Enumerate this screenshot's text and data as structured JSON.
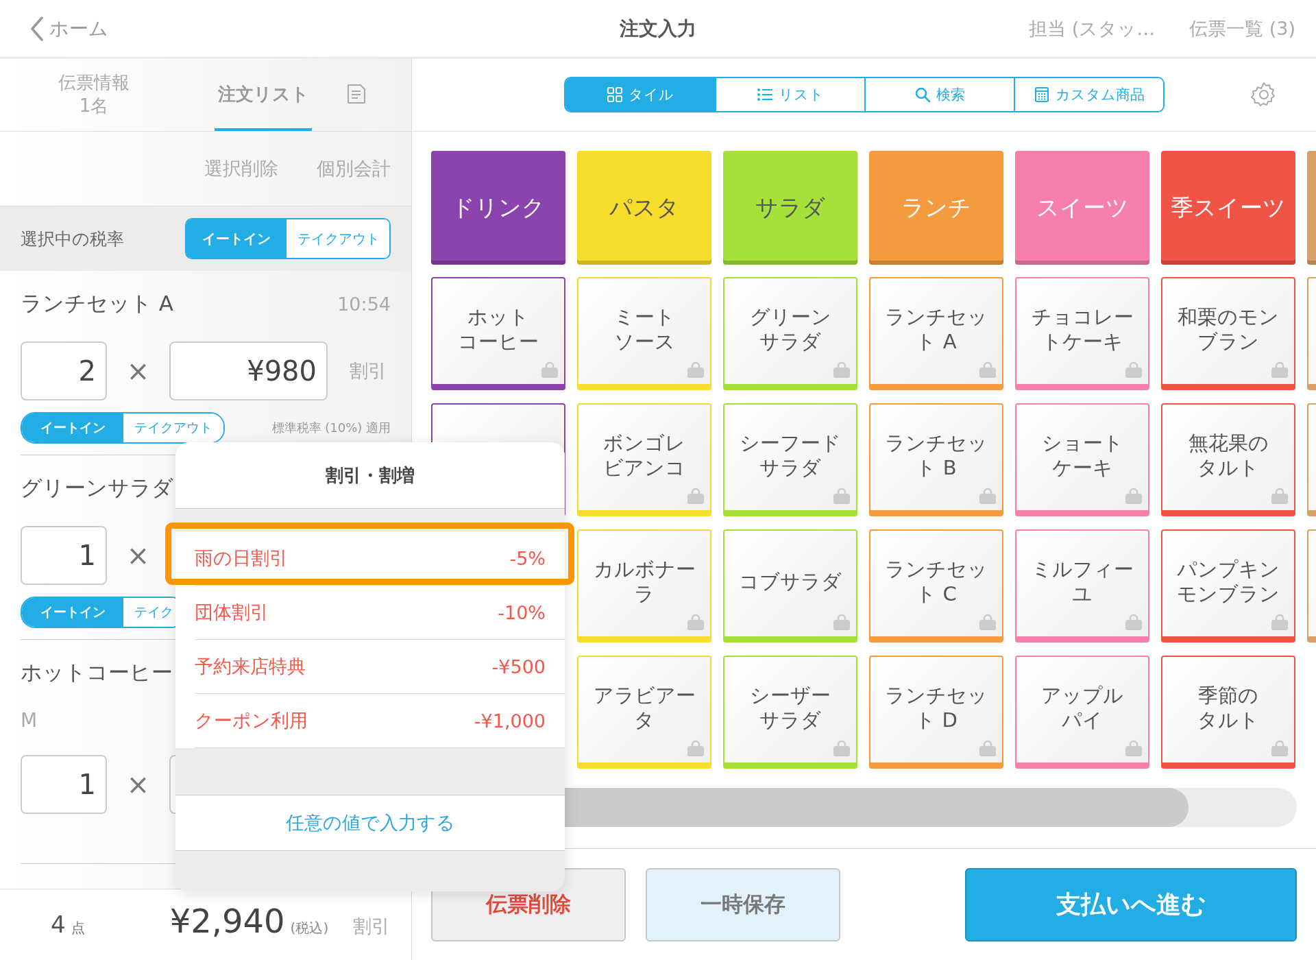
{
  "top_bar": {
    "back": "ホーム",
    "title": "注文入力",
    "staff": "担当 (スタッ…",
    "slips": "伝票一覧 (3)"
  },
  "left_tabs": [
    {
      "label": "伝票情報",
      "sub": "1名",
      "selected": false
    },
    {
      "label": "注文リスト",
      "selected": true
    }
  ],
  "list_actions": [
    "選択削除",
    "個別会計"
  ],
  "tax_rate": {
    "label": "選択中の税率",
    "options": [
      {
        "label": "イートイン",
        "selected": true
      },
      {
        "label": "テイクアウト",
        "selected": false
      }
    ]
  },
  "order_items": [
    {
      "name": "ランチセット A",
      "time": "10:54",
      "qty": "2",
      "times": "×",
      "price": "¥980",
      "discount": "割引",
      "tax_options": [
        {
          "label": "イートイン",
          "selected": true
        },
        {
          "label": "テイクアウト",
          "selected": false
        }
      ],
      "tax_note": "標準税率 (10%) 適用"
    },
    {
      "name": "グリーンサラダ",
      "qty": "1",
      "times": "×",
      "tax_options": [
        {
          "label": "イートイン",
          "selected": true
        },
        {
          "label": "テイク",
          "selected": false
        }
      ]
    },
    {
      "name": "ホットコーヒー",
      "variant": "M",
      "qty": "1",
      "times": "×"
    }
  ],
  "summary": {
    "count": "4",
    "count_unit": "点",
    "total": "¥2,940",
    "tax_note": "(税込)",
    "discount": "割引"
  },
  "view_modes": [
    {
      "label": "タイル",
      "kind": "tiles",
      "selected": true
    },
    {
      "label": "リスト",
      "kind": "list",
      "selected": false
    },
    {
      "label": "検索",
      "kind": "search",
      "selected": false
    },
    {
      "label": "カスタム商品",
      "kind": "custom",
      "selected": false
    }
  ],
  "categories": [
    {
      "name": "ドリンク",
      "color": "#8b44ad",
      "items": [
        {
          "kind": "product",
          "lines": [
            "ホット",
            "コーヒー"
          ]
        },
        {
          "kind": "blank"
        }
      ]
    },
    {
      "name": "パスタ",
      "color": "#f8dc2c",
      "items": [
        {
          "lines": [
            "ミート",
            "ソース"
          ]
        },
        {
          "lines": [
            "ボンゴレ",
            "ビアンコ"
          ]
        },
        {
          "lines": [
            "カルボナー",
            "ラ"
          ]
        },
        {
          "lines": [
            "アラビアー",
            "タ"
          ]
        }
      ]
    },
    {
      "name": "サラダ",
      "color": "#a6e03a",
      "items": [
        {
          "lines": [
            "グリーン",
            "サラダ"
          ]
        },
        {
          "lines": [
            "シーフード",
            "サラダ"
          ]
        },
        {
          "lines": [
            "コブサラダ"
          ]
        },
        {
          "lines": [
            "シーザー",
            "サラダ"
          ]
        }
      ]
    },
    {
      "name": "ランチ",
      "color": "#f59b3f",
      "items": [
        {
          "lines": [
            "ランチセッ",
            "ト A"
          ]
        },
        {
          "lines": [
            "ランチセッ",
            "ト B"
          ]
        },
        {
          "lines": [
            "ランチセッ",
            "ト C"
          ]
        },
        {
          "lines": [
            "ランチセッ",
            "ト D"
          ]
        }
      ]
    },
    {
      "name": "スイーツ",
      "color": "#f77fab",
      "items": [
        {
          "lines": [
            "チョコレー",
            "トケーキ"
          ]
        },
        {
          "lines": [
            "ショート",
            "ケーキ"
          ]
        },
        {
          "lines": [
            "ミルフィー",
            "ユ"
          ]
        },
        {
          "lines": [
            "アップル",
            "パイ"
          ]
        }
      ]
    },
    {
      "name": "季スイーツ",
      "color": "#f05446",
      "items": [
        {
          "lines": [
            "和栗のモン",
            "ブラン"
          ]
        },
        {
          "lines": [
            "無花果の",
            "タルト"
          ]
        },
        {
          "lines": [
            "パンプキン",
            "モンブラン"
          ]
        },
        {
          "lines": [
            "季節の",
            "タルト"
          ]
        }
      ]
    },
    {
      "color": "#d9a066",
      "items": [
        {
          "kind": "blank"
        },
        {
          "kind": "blank"
        },
        {
          "kind": "blank"
        }
      ]
    }
  ],
  "discount_popover": {
    "title": "割引・割増",
    "items": [
      {
        "name": "雨の日割引",
        "value": "-5%",
        "highlighted": true
      },
      {
        "name": "団体割引",
        "value": "-10%",
        "highlighted": false
      },
      {
        "name": "予約来店特典",
        "value": "-¥500",
        "highlighted": false
      },
      {
        "name": "クーポン利用",
        "value": "-¥1,000",
        "highlighted": false
      }
    ],
    "custom": "任意の値で入力する"
  },
  "actions": [
    {
      "label": "伝票削除",
      "kind": "delete"
    },
    {
      "label": "一時保存",
      "kind": "hold"
    },
    {
      "label": "支払いへ進む",
      "kind": "pay"
    }
  ]
}
